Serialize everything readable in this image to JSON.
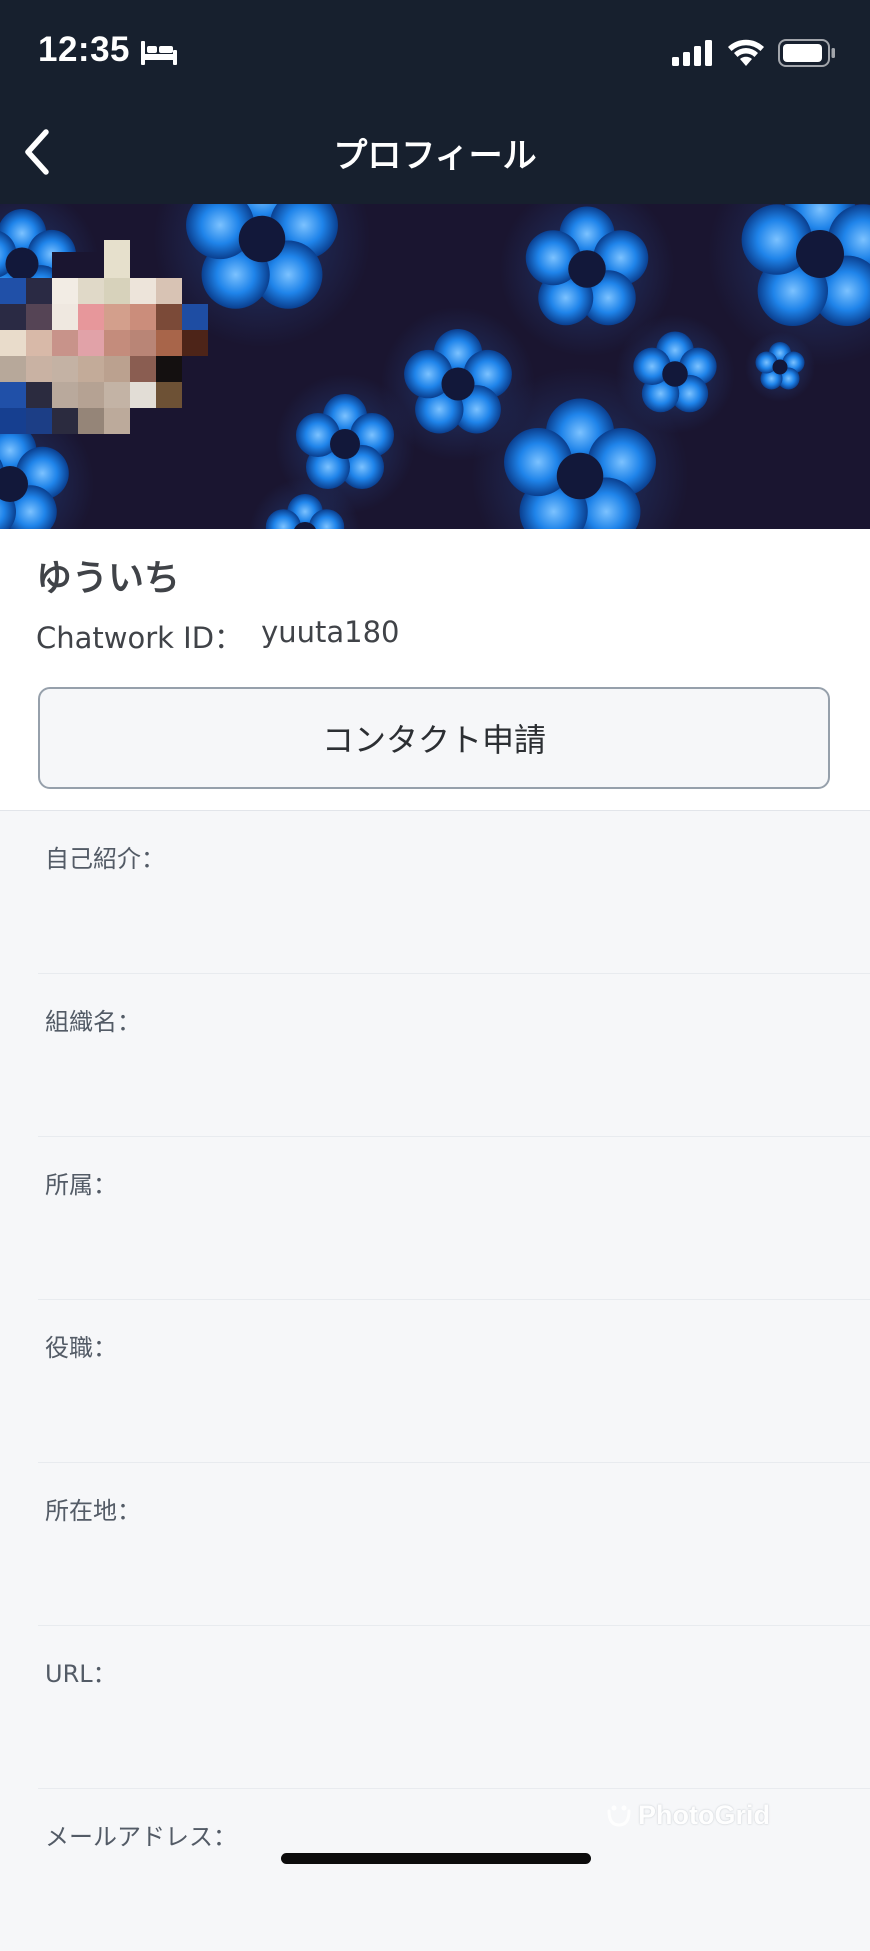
{
  "status_bar": {
    "time": "12:35"
  },
  "nav": {
    "title": "プロフィール"
  },
  "profile": {
    "name": "ゆういち",
    "id_label": "Chatwork ID：",
    "id_value": "yuuta180",
    "contact_button_label": "コンタクト申請"
  },
  "fields": [
    {
      "label": "自己紹介："
    },
    {
      "label": "組織名："
    },
    {
      "label": "所属："
    },
    {
      "label": "役職："
    },
    {
      "label": "所在地："
    },
    {
      "label": "URL："
    },
    {
      "label": "メールアドレス："
    }
  ],
  "watermark": {
    "text": "PhotoGrid"
  },
  "colors": {
    "header_bg": "#17202e",
    "cover_bg": "#1a1530",
    "flower_blue": "#1a7de0",
    "page_bg": "#f6f7f9"
  }
}
